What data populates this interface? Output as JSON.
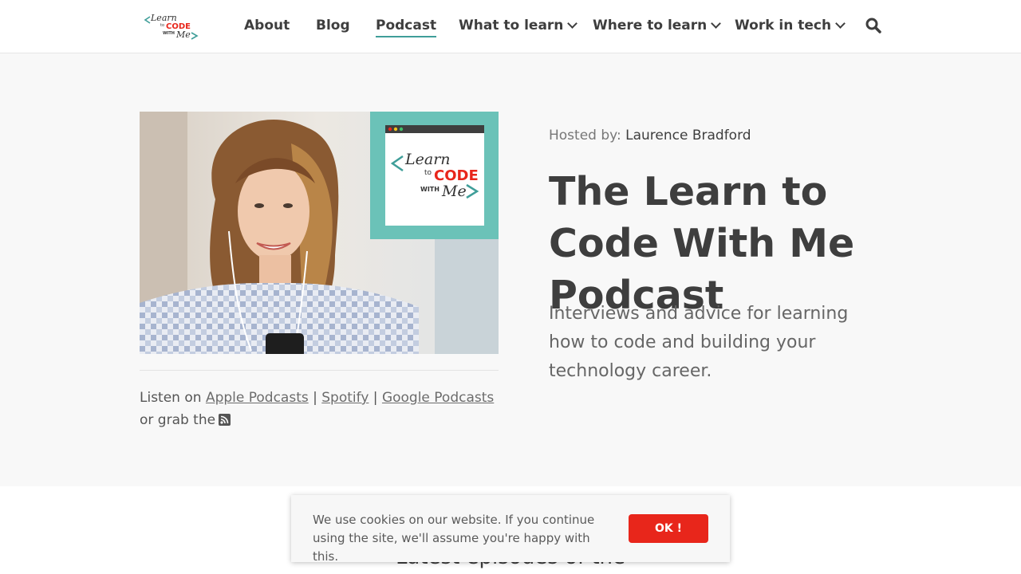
{
  "header": {
    "logo_alt": "Learn to Code With Me",
    "nav": [
      {
        "label": "About"
      },
      {
        "label": "Blog"
      },
      {
        "label": "Podcast"
      },
      {
        "label": "What to learn"
      },
      {
        "label": "Where to learn"
      },
      {
        "label": "Work in tech"
      }
    ]
  },
  "hero": {
    "logo_text": {
      "learn": "Learn",
      "to": "to",
      "code": "CODE",
      "with": "WITH",
      "me": "Me"
    },
    "listen_prefix": "Listen on",
    "links": [
      "Apple Podcasts",
      "Spotify",
      "Google Podcasts"
    ],
    "separator": "|",
    "listen_suffix": "or grab the",
    "hosted_label": "Hosted by:",
    "host_name": "Laurence Bradford",
    "title": "The Learn to Code With Me Podcast",
    "description": "Interviews and advice for learning how to code and building your technology career."
  },
  "latest_heading": "Latest episodes of the",
  "cookie": {
    "text": "We use cookies on our website. If you continue using the site, we'll assume you're happy with this.",
    "button": "OK !"
  },
  "colors": {
    "teal": "#6bc2b8",
    "accent": "#3f9e99",
    "red": "#e8261b"
  }
}
